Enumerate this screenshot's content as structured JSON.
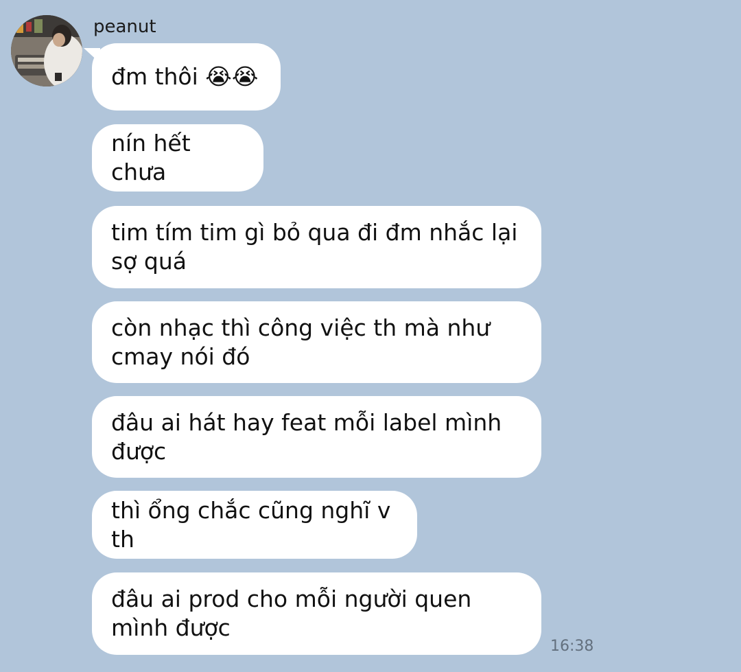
{
  "chat": {
    "sender_name": "peanut",
    "messages": [
      {
        "text": "đm thôi 😭😭"
      },
      {
        "text": "nín hết chưa"
      },
      {
        "text": "tim tím tim gì bỏ qua đi đm nhắc lại sợ quá"
      },
      {
        "text": "còn nhạc thì công việc th mà như cmay nói đó"
      },
      {
        "text": "đâu ai hát hay feat mỗi label mình được"
      },
      {
        "text": "thì ổng chắc cũng nghĩ v th"
      },
      {
        "text": "đâu ai prod cho mỗi người quen mình được"
      }
    ],
    "last_timestamp": "16:38"
  },
  "colors": {
    "background": "#b1c5da",
    "bubble": "#ffffff",
    "text": "#111111",
    "timestamp": "#63707e"
  },
  "icons": {
    "avatar": "profile-photo"
  }
}
